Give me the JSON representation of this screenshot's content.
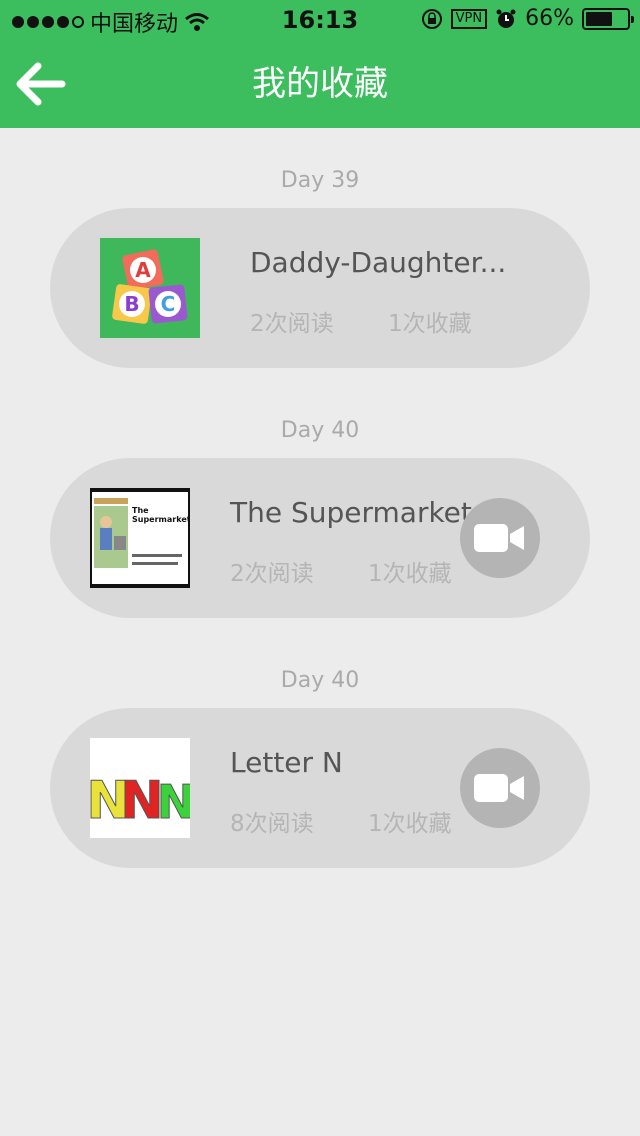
{
  "status_bar": {
    "carrier": "中国移动",
    "time": "16:13",
    "vpn": "VPN",
    "battery": "66%",
    "battery_level": 0.66
  },
  "nav": {
    "title": "我的收藏"
  },
  "items": [
    {
      "day": "Day 39",
      "title": "Daddy-Daughter...",
      "reads": "2次阅读",
      "favorites": "1次收藏",
      "thumbnail": "abc-blocks-image",
      "has_video": false
    },
    {
      "day": "Day 40",
      "title": "The Supermarket",
      "reads": "2次阅读",
      "favorites": "1次收藏",
      "thumbnail": "supermarket-book-cover",
      "thumbnail_text": "The Supermarket",
      "has_video": true
    },
    {
      "day": "Day 40",
      "title": "Letter N",
      "reads": "8次阅读",
      "favorites": "1次收藏",
      "thumbnail": "letter-n-image",
      "has_video": true
    }
  ],
  "colors": {
    "header_green": "#3dbe5e",
    "background": "#ececec",
    "card": "#d9d9d9"
  }
}
